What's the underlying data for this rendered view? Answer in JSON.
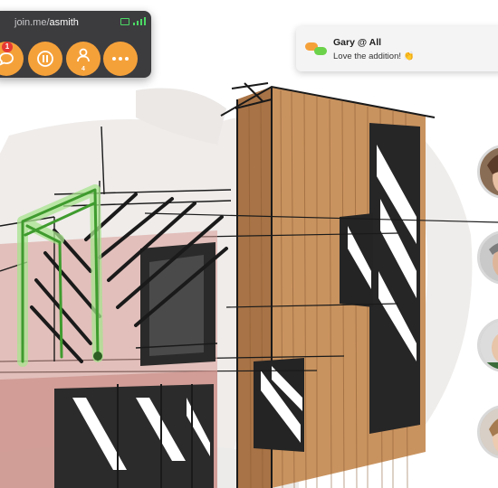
{
  "meeting": {
    "url_prefix": "join.me/",
    "url_user": "asmith",
    "chat_badge": "1",
    "people_count": "4"
  },
  "icons": {
    "chat": "chat-icon",
    "pause": "pause-icon",
    "people": "person-icon",
    "more": "more-icon",
    "signal": "signal-icon",
    "screen": "screen-share-icon"
  },
  "notification": {
    "sender": "Gary @ All",
    "message": "Love the addition! 👏"
  },
  "colors": {
    "toolbar_bg": "#3c3c3f",
    "accent_orange": "#f5a13a",
    "badge_red": "#e53935",
    "signal_green": "#4cd964",
    "highlight_green": "#6cd24a",
    "wood": "#c9935f"
  },
  "participants": [
    {
      "name": "participant-1"
    },
    {
      "name": "participant-2"
    },
    {
      "name": "participant-3"
    },
    {
      "name": "participant-4"
    }
  ]
}
